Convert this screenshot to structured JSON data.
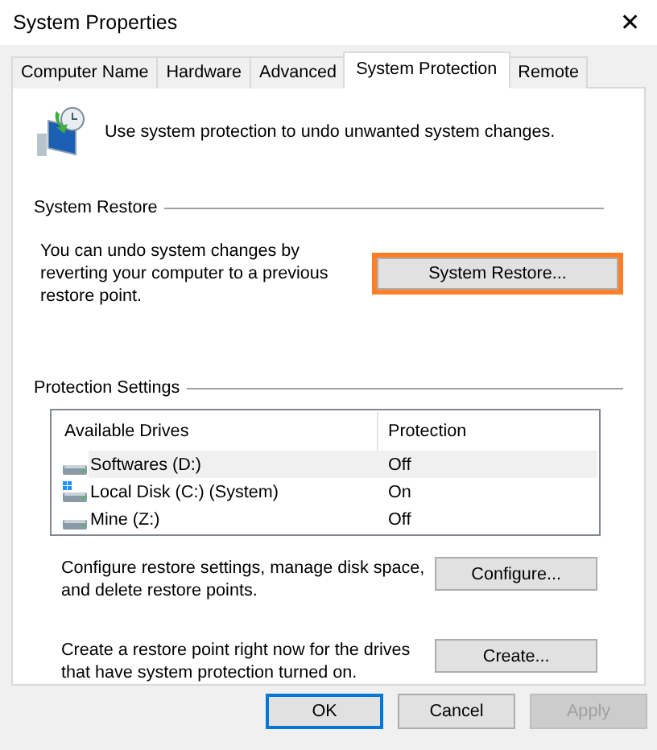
{
  "window": {
    "title": "System Properties",
    "close": "✕"
  },
  "tabs": [
    {
      "label": "Computer Name",
      "selected": false
    },
    {
      "label": "Hardware",
      "selected": false
    },
    {
      "label": "Advanced",
      "selected": false
    },
    {
      "label": "System Protection",
      "selected": true
    },
    {
      "label": "Remote",
      "selected": false
    }
  ],
  "intro": "Use system protection to undo unwanted system changes.",
  "system_restore": {
    "heading": "System Restore",
    "text": "You can undo system changes by reverting your computer to a previous restore point.",
    "button": {
      "label": "System Restore...",
      "highlighted": true
    }
  },
  "protection_settings": {
    "heading": "Protection Settings",
    "columns": [
      "Available Drives",
      "Protection"
    ],
    "drives": [
      {
        "name": "Softwares (D:)",
        "protection": "Off",
        "kind": "drive",
        "selected": true
      },
      {
        "name": "Local Disk (C:) (System)",
        "protection": "On",
        "kind": "system",
        "selected": false
      },
      {
        "name": "Mine (Z:)",
        "protection": "Off",
        "kind": "drive",
        "selected": false
      }
    ],
    "actions": [
      {
        "text": "Configure restore settings, manage disk space, and delete restore points.",
        "button": "Configure..."
      },
      {
        "text": "Create a restore point right now for the drives that have system protection turned on.",
        "button": "Create..."
      }
    ]
  },
  "buttons": [
    {
      "label": "OK",
      "default": true,
      "disabled": false
    },
    {
      "label": "Cancel",
      "default": false,
      "disabled": false
    },
    {
      "label": "Apply",
      "default": false,
      "disabled": true
    }
  ]
}
